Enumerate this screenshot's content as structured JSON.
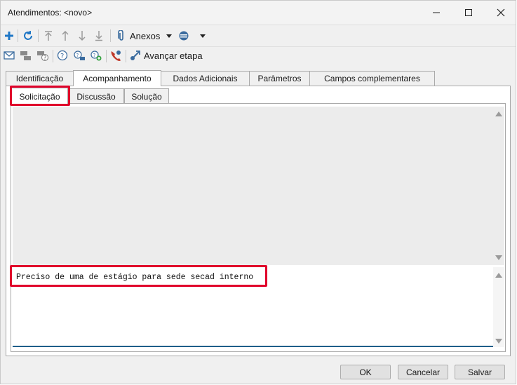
{
  "window": {
    "title": "Atendimentos: <novo>"
  },
  "toolbar1": {
    "anexos_label": "Anexos"
  },
  "toolbar2": {
    "avancar_label": "Avançar etapa"
  },
  "tabs": [
    {
      "label": "Identificação"
    },
    {
      "label": "Acompanhamento"
    },
    {
      "label": "Dados Adicionais"
    },
    {
      "label": "Parâmetros"
    },
    {
      "label": "Campos complementares"
    }
  ],
  "subtabs": [
    {
      "label": "Solicitação"
    },
    {
      "label": "Discussão"
    },
    {
      "label": "Solução"
    }
  ],
  "editor": {
    "text": "Preciso de uma de estágio para sede secad interno"
  },
  "buttons": {
    "ok": "OK",
    "cancel": "Cancelar",
    "save": "Salvar"
  },
  "colors": {
    "accent": "#1f5e8a",
    "highlight": "#e0002a",
    "add": "#1f77c6",
    "green": "#2e9e3a"
  }
}
